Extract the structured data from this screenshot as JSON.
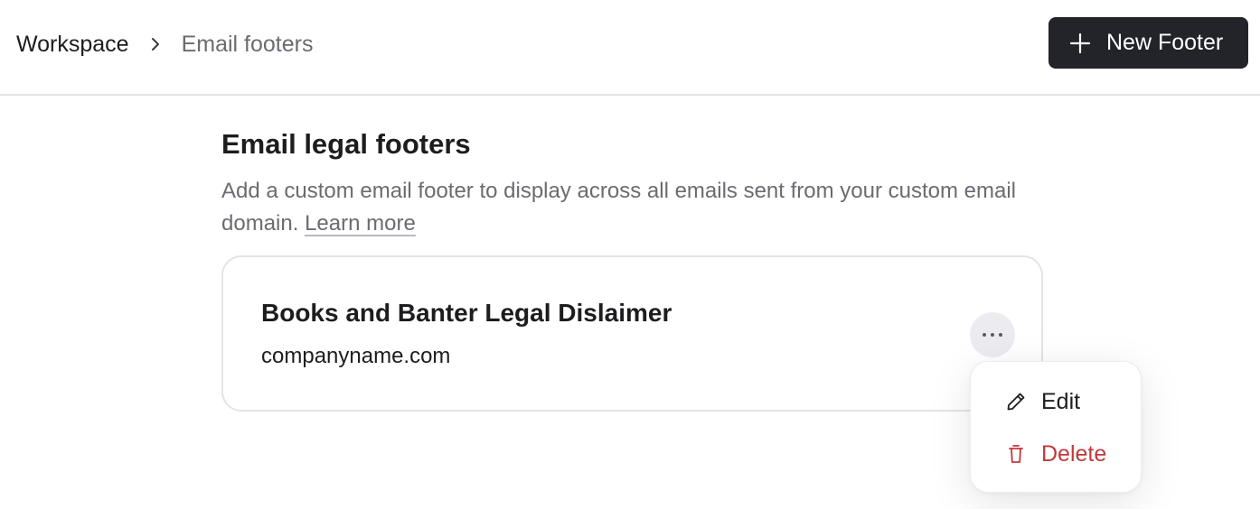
{
  "breadcrumb": {
    "root": "Workspace",
    "current": "Email footers"
  },
  "header": {
    "new_footer_label": "New Footer"
  },
  "section": {
    "title": "Email legal footers",
    "description": "Add a custom email footer to display across all emails sent from your custom email domain.",
    "learn_more": "Learn more"
  },
  "footer_card": {
    "title": "Books and Banter Legal Dislaimer",
    "domain": "companyname.com"
  },
  "menu": {
    "edit_label": "Edit",
    "delete_label": "Delete"
  },
  "icons": {
    "breadcrumb_separator": "chevron-right-icon",
    "new_footer": "plus-icon",
    "more": "more-horizontal-icon",
    "edit": "pencil-icon",
    "delete": "trash-icon"
  },
  "colors": {
    "primary_button": "#23232a",
    "danger": "#c0393b",
    "muted_text": "#6b6b72"
  }
}
